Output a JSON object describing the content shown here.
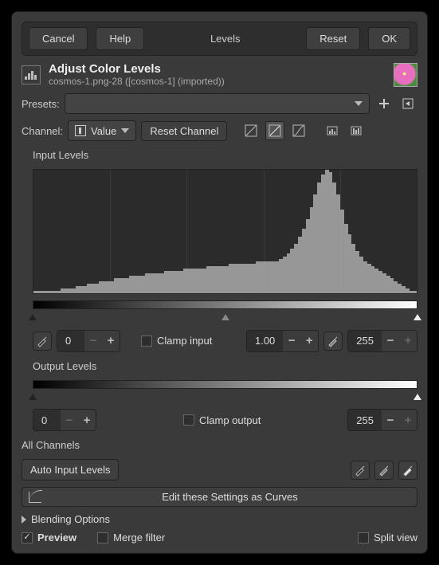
{
  "topbar": {
    "cancel": "Cancel",
    "help": "Help",
    "title": "Levels",
    "reset": "Reset",
    "ok": "OK"
  },
  "header": {
    "title": "Adjust Color Levels",
    "subtitle": "cosmos-1.png-28 ([cosmos-1] (imported))"
  },
  "presets_label": "Presets:",
  "channel": {
    "label": "Channel:",
    "value": "Value",
    "reset": "Reset Channel"
  },
  "input_levels": {
    "title": "Input Levels",
    "low": "0",
    "gamma": "1.00",
    "high": "255",
    "clamp": "Clamp input"
  },
  "output_levels": {
    "title": "Output Levels",
    "low": "0",
    "high": "255",
    "clamp": "Clamp output"
  },
  "all_channels": {
    "title": "All Channels",
    "auto": "Auto Input Levels"
  },
  "curves_button": "Edit these Settings as Curves",
  "blending": "Blending Options",
  "footer": {
    "preview": "Preview",
    "merge": "Merge filter",
    "split": "Split view"
  },
  "histogram_values": [
    1,
    1,
    1,
    1,
    1,
    1,
    1,
    2,
    2,
    2,
    2,
    3,
    3,
    3,
    4,
    4,
    4,
    5,
    5,
    5,
    5,
    6,
    6,
    6,
    6,
    7,
    7,
    7,
    7,
    8,
    8,
    8,
    8,
    8,
    9,
    9,
    9,
    9,
    9,
    10,
    10,
    10,
    10,
    10,
    10,
    11,
    11,
    11,
    11,
    11,
    11,
    12,
    12,
    12,
    12,
    12,
    12,
    12,
    13,
    13,
    13,
    13,
    13,
    13,
    14,
    15,
    16,
    18,
    20,
    23,
    26,
    30,
    35,
    40,
    45,
    48,
    50,
    49,
    45,
    40,
    34,
    28,
    24,
    20,
    17,
    15,
    13,
    12,
    11,
    10,
    9,
    8,
    7,
    6,
    5,
    4,
    3,
    2,
    1,
    1
  ]
}
